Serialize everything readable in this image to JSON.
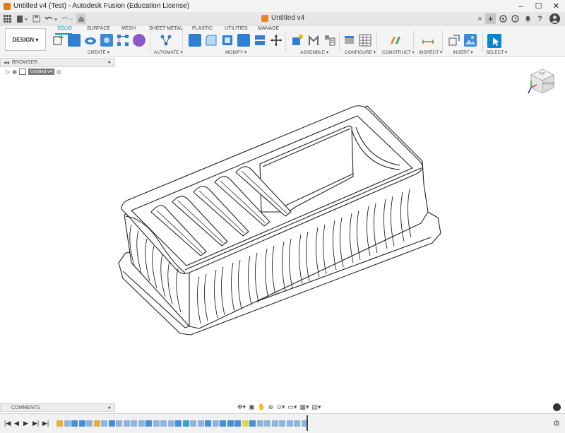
{
  "window": {
    "title": "Untitled v4 (Test) - Autodesk Fusion (Education License)",
    "minimize": "–",
    "maximize": "☐",
    "close": "✕"
  },
  "tabbar": {
    "doc_tab_label": "Untitled v4",
    "doc_tab_close": "×",
    "new_tab": "+",
    "help": "?"
  },
  "ribbon": {
    "workspace": "DESIGN ▾",
    "tabs": [
      "SOLID",
      "SURFACE",
      "MESH",
      "SHEET METAL",
      "PLASTIC",
      "UTILITIES",
      "MANAGE"
    ],
    "active_tab": "SOLID",
    "groups": [
      "CREATE ▾",
      "AUTOMATE ▾",
      "MODIFY ▾",
      "ASSEMBLE ▾",
      "CONFIGURE ▾",
      "CONSTRUCT ▾",
      "INSPECT ▾",
      "INSERT ▾",
      "SELECT ▾"
    ],
    "accent": "#0696d7"
  },
  "browser": {
    "title": "BROWSER",
    "root_item": "Untitled v4"
  },
  "viewcube": {
    "face_front": "FRONT",
    "face_top": "TOP"
  },
  "comments": {
    "title": "COMMENTS"
  }
}
